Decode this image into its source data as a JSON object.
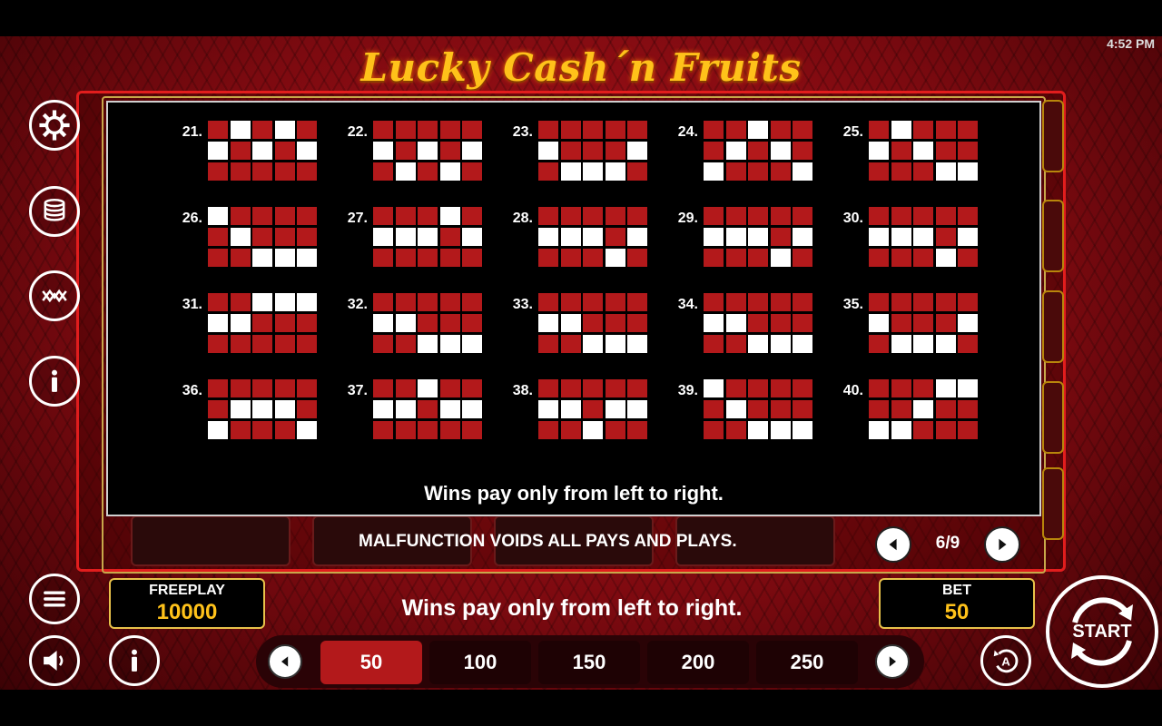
{
  "status": {
    "time": "4:52 PM"
  },
  "game": {
    "title": "Lucky Cash´n Fruits"
  },
  "paytable": {
    "lines": [
      {
        "number": "21.",
        "pattern": [
          [
            0,
            1,
            0,
            1,
            0
          ],
          [
            1,
            0,
            1,
            0,
            1
          ],
          [
            0,
            0,
            0,
            0,
            0
          ]
        ]
      },
      {
        "number": "22.",
        "pattern": [
          [
            0,
            0,
            0,
            0,
            0
          ],
          [
            1,
            0,
            1,
            0,
            1
          ],
          [
            0,
            1,
            0,
            1,
            0
          ]
        ]
      },
      {
        "number": "23.",
        "pattern": [
          [
            0,
            0,
            0,
            0,
            0
          ],
          [
            1,
            0,
            0,
            0,
            1
          ],
          [
            0,
            1,
            1,
            1,
            0
          ]
        ]
      },
      {
        "number": "24.",
        "pattern": [
          [
            0,
            0,
            1,
            0,
            0
          ],
          [
            0,
            1,
            0,
            1,
            0
          ],
          [
            1,
            0,
            0,
            0,
            1
          ]
        ]
      },
      {
        "number": "25.",
        "pattern": [
          [
            0,
            1,
            0,
            0,
            0
          ],
          [
            1,
            0,
            1,
            0,
            0
          ],
          [
            0,
            0,
            0,
            1,
            1
          ]
        ]
      },
      {
        "number": "26.",
        "pattern": [
          [
            1,
            0,
            0,
            0,
            0
          ],
          [
            0,
            1,
            0,
            0,
            0
          ],
          [
            0,
            0,
            1,
            1,
            1
          ]
        ]
      },
      {
        "number": "27.",
        "pattern": [
          [
            0,
            0,
            0,
            1,
            0
          ],
          [
            1,
            1,
            1,
            0,
            1
          ],
          [
            0,
            0,
            0,
            0,
            0
          ]
        ]
      },
      {
        "number": "28.",
        "pattern": [
          [
            0,
            0,
            0,
            0,
            0
          ],
          [
            1,
            1,
            1,
            0,
            1
          ],
          [
            0,
            0,
            0,
            1,
            0
          ]
        ]
      },
      {
        "number": "29.",
        "pattern": [
          [
            0,
            0,
            0,
            0,
            0
          ],
          [
            1,
            1,
            1,
            0,
            1
          ],
          [
            0,
            0,
            0,
            1,
            0
          ]
        ]
      },
      {
        "number": "30.",
        "pattern": [
          [
            0,
            0,
            0,
            0,
            0
          ],
          [
            1,
            1,
            1,
            0,
            1
          ],
          [
            0,
            0,
            0,
            1,
            0
          ]
        ]
      },
      {
        "number": "31.",
        "pattern": [
          [
            0,
            0,
            1,
            1,
            1
          ],
          [
            1,
            1,
            0,
            0,
            0
          ],
          [
            0,
            0,
            0,
            0,
            0
          ]
        ]
      },
      {
        "number": "32.",
        "pattern": [
          [
            0,
            0,
            0,
            0,
            0
          ],
          [
            1,
            1,
            0,
            0,
            0
          ],
          [
            0,
            0,
            1,
            1,
            1
          ]
        ]
      },
      {
        "number": "33.",
        "pattern": [
          [
            0,
            0,
            0,
            0,
            0
          ],
          [
            1,
            1,
            0,
            0,
            0
          ],
          [
            0,
            0,
            1,
            1,
            1
          ]
        ]
      },
      {
        "number": "34.",
        "pattern": [
          [
            0,
            0,
            0,
            0,
            0
          ],
          [
            1,
            1,
            0,
            0,
            0
          ],
          [
            0,
            0,
            1,
            1,
            1
          ]
        ]
      },
      {
        "number": "35.",
        "pattern": [
          [
            0,
            0,
            0,
            0,
            0
          ],
          [
            1,
            0,
            0,
            0,
            1
          ],
          [
            0,
            1,
            1,
            1,
            0
          ]
        ]
      },
      {
        "number": "36.",
        "pattern": [
          [
            0,
            0,
            0,
            0,
            0
          ],
          [
            0,
            1,
            1,
            1,
            0
          ],
          [
            1,
            0,
            0,
            0,
            1
          ]
        ]
      },
      {
        "number": "37.",
        "pattern": [
          [
            0,
            0,
            1,
            0,
            0
          ],
          [
            1,
            1,
            0,
            1,
            1
          ],
          [
            0,
            0,
            0,
            0,
            0
          ]
        ]
      },
      {
        "number": "38.",
        "pattern": [
          [
            0,
            0,
            0,
            0,
            0
          ],
          [
            1,
            1,
            0,
            1,
            1
          ],
          [
            0,
            0,
            1,
            0,
            0
          ]
        ]
      },
      {
        "number": "39.",
        "pattern": [
          [
            1,
            0,
            0,
            0,
            0
          ],
          [
            0,
            1,
            0,
            0,
            0
          ],
          [
            0,
            0,
            1,
            1,
            1
          ]
        ]
      },
      {
        "number": "40.",
        "pattern": [
          [
            0,
            0,
            0,
            1,
            1
          ],
          [
            0,
            0,
            1,
            0,
            0
          ],
          [
            1,
            1,
            0,
            0,
            0
          ]
        ]
      }
    ],
    "note": "Wins pay only from left to right."
  },
  "footer_notice": "MALFUNCTION VOIDS ALL PAYS AND PLAYS.",
  "pagination": {
    "current": "6/9"
  },
  "freeplay": {
    "label": "FREEPLAY",
    "value": "10000"
  },
  "bet": {
    "label": "BET",
    "value": "50"
  },
  "bottom_message": "Wins pay only from left to right.",
  "bet_options": [
    {
      "label": "50",
      "selected": true
    },
    {
      "label": "100",
      "selected": false
    },
    {
      "label": "150",
      "selected": false
    },
    {
      "label": "200",
      "selected": false
    },
    {
      "label": "250",
      "selected": false
    }
  ],
  "start_label": "START",
  "icons": {
    "settings": "gear-icon",
    "coins": "coin-stack-icon",
    "lines": "paylines-icon",
    "info": "info-icon",
    "menu": "menu-icon",
    "sound": "speaker-icon",
    "autoplay": "autoplay-icon"
  },
  "colors": {
    "accent_red": "#b3191b",
    "gold": "#ffc21a",
    "line_on": "#ffffff"
  }
}
